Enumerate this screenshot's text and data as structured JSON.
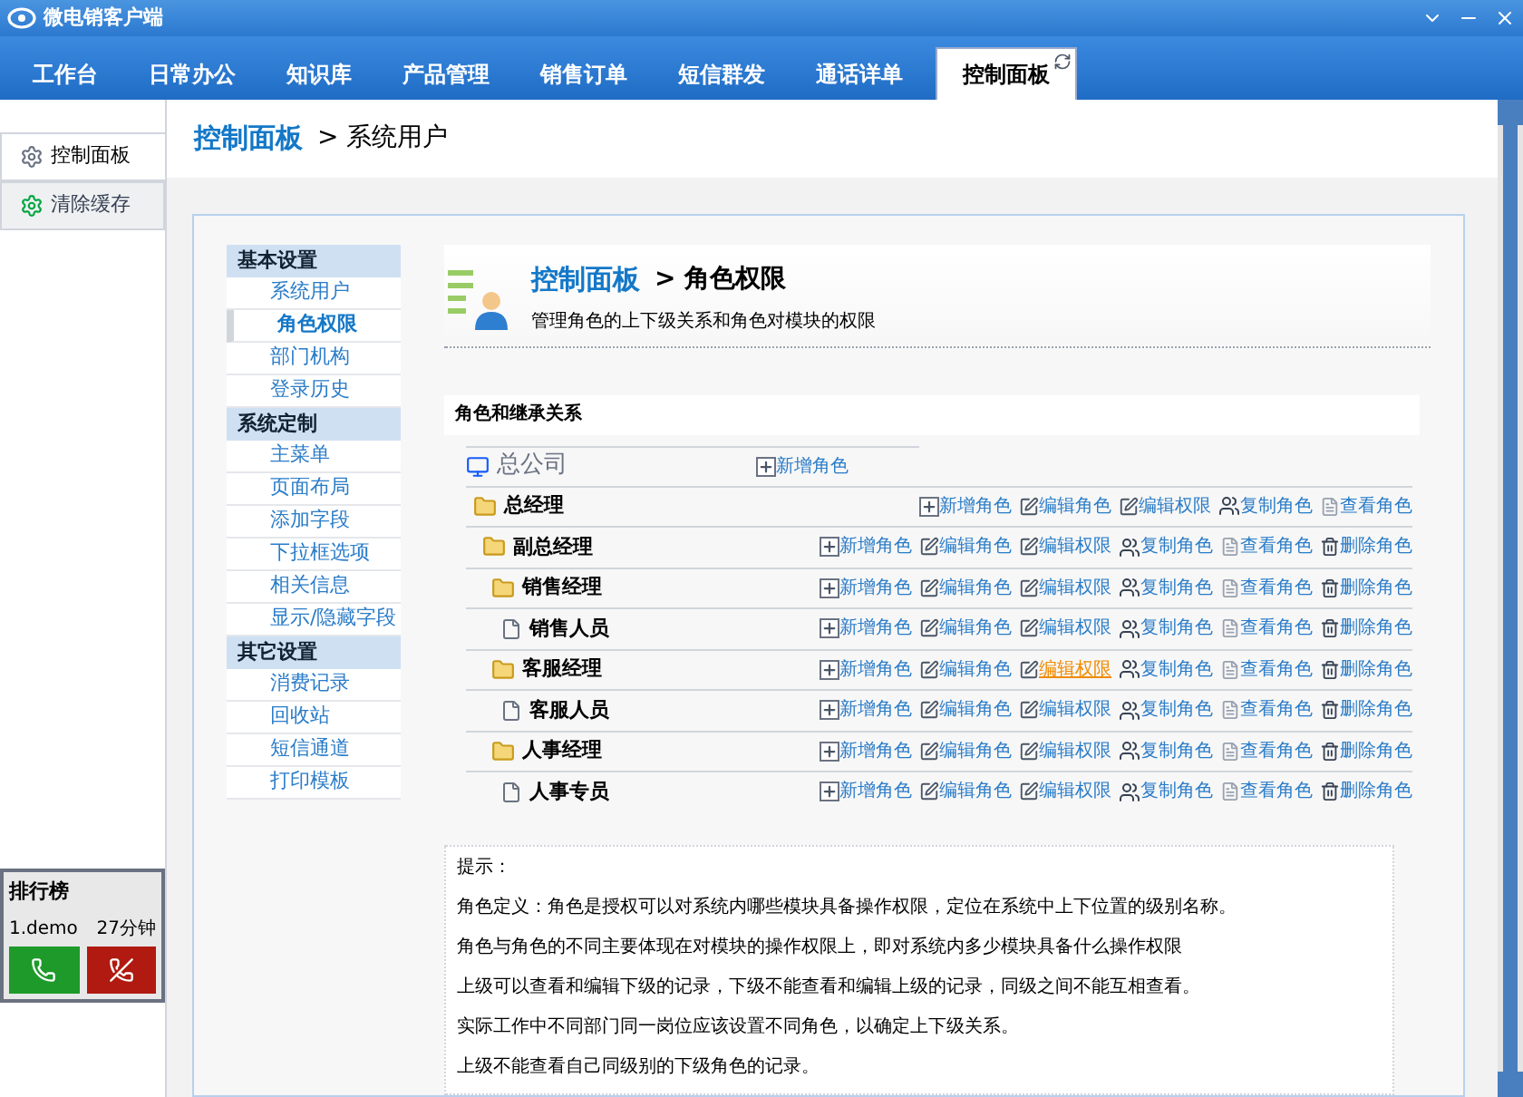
{
  "window": {
    "title": "微电销客户端"
  },
  "tabs": [
    {
      "label": "工作台",
      "selected": false
    },
    {
      "label": "日常办公",
      "selected": false
    },
    {
      "label": "知识库",
      "selected": false
    },
    {
      "label": "产品管理",
      "selected": false
    },
    {
      "label": "销售订单",
      "selected": false
    },
    {
      "label": "短信群发",
      "selected": false
    },
    {
      "label": "通话详单",
      "selected": false
    },
    {
      "label": "控制面板",
      "selected": true
    }
  ],
  "sidebar": {
    "items": [
      {
        "label": "控制面板",
        "selected": true
      },
      {
        "label": "清除缓存",
        "selected": false
      }
    ],
    "ranking": {
      "title": "排行榜",
      "rows": [
        {
          "name": "1.demo",
          "time": "27分钟"
        }
      ]
    }
  },
  "breadcrumb": {
    "root": "控制面板",
    "current": "> 系统用户"
  },
  "nav": [
    {
      "title": "基本设置",
      "items": [
        {
          "label": "系统用户",
          "selected": false
        },
        {
          "label": "角色权限",
          "selected": true
        },
        {
          "label": "部门机构",
          "selected": false
        },
        {
          "label": "登录历史",
          "selected": false
        }
      ]
    },
    {
      "title": "系统定制",
      "items": [
        {
          "label": "主菜单",
          "selected": false
        },
        {
          "label": "页面布局",
          "selected": false
        },
        {
          "label": "添加字段",
          "selected": false
        },
        {
          "label": "下拉框选项",
          "selected": false
        },
        {
          "label": "相关信息",
          "selected": false
        },
        {
          "label": "显示/隐藏字段",
          "selected": false
        }
      ]
    },
    {
      "title": "其它设置",
      "items": [
        {
          "label": "消费记录",
          "selected": false
        },
        {
          "label": "回收站",
          "selected": false
        },
        {
          "label": "短信通道",
          "selected": false
        },
        {
          "label": "打印模板",
          "selected": false
        }
      ]
    }
  ],
  "header": {
    "root": "控制面板",
    "current": "> 角色权限",
    "subtitle": "管理角色的上下级关系和角色对模块的权限"
  },
  "tree": {
    "title": "角色和继承关系",
    "root": {
      "name": "总公司",
      "kind": "company",
      "actions": [
        {
          "kind": "add",
          "label": "新增角色",
          "highlighted": false
        }
      ],
      "children": [
        {
          "name": "总经理",
          "kind": "folder",
          "actions": [
            {
              "kind": "add",
              "label": "新增角色",
              "highlighted": false
            },
            {
              "kind": "edit",
              "label": "编辑角色",
              "highlighted": false
            },
            {
              "kind": "edit",
              "label": "编辑权限",
              "highlighted": false
            },
            {
              "kind": "copy",
              "label": "复制角色",
              "highlighted": false
            },
            {
              "kind": "view",
              "label": "查看角色",
              "highlighted": false
            }
          ],
          "children": [
            {
              "name": "副总经理",
              "kind": "folder",
              "actions": [
                {
                  "kind": "add",
                  "label": "新增角色",
                  "highlighted": false
                },
                {
                  "kind": "edit",
                  "label": "编辑角色",
                  "highlighted": false
                },
                {
                  "kind": "edit",
                  "label": "编辑权限",
                  "highlighted": false
                },
                {
                  "kind": "copy",
                  "label": "复制角色",
                  "highlighted": false
                },
                {
                  "kind": "view",
                  "label": "查看角色",
                  "highlighted": false
                },
                {
                  "kind": "delete",
                  "label": "删除角色",
                  "highlighted": false
                }
              ],
              "children": [
                {
                  "name": "销售经理",
                  "kind": "folder",
                  "actions": [
                    {
                      "kind": "add",
                      "label": "新增角色",
                      "highlighted": false
                    },
                    {
                      "kind": "edit",
                      "label": "编辑角色",
                      "highlighted": false
                    },
                    {
                      "kind": "edit",
                      "label": "编辑权限",
                      "highlighted": false
                    },
                    {
                      "kind": "copy",
                      "label": "复制角色",
                      "highlighted": false
                    },
                    {
                      "kind": "view",
                      "label": "查看角色",
                      "highlighted": false
                    },
                    {
                      "kind": "delete",
                      "label": "删除角色",
                      "highlighted": false
                    }
                  ],
                  "children": [
                    {
                      "name": "销售人员",
                      "kind": "doc",
                      "actions": [
                        {
                          "kind": "add",
                          "label": "新增角色",
                          "highlighted": false
                        },
                        {
                          "kind": "edit",
                          "label": "编辑角色",
                          "highlighted": false
                        },
                        {
                          "kind": "edit",
                          "label": "编辑权限",
                          "highlighted": false
                        },
                        {
                          "kind": "copy",
                          "label": "复制角色",
                          "highlighted": false
                        },
                        {
                          "kind": "view",
                          "label": "查看角色",
                          "highlighted": false
                        },
                        {
                          "kind": "delete",
                          "label": "删除角色",
                          "highlighted": false
                        }
                      ]
                    }
                  ]
                },
                {
                  "name": "客服经理",
                  "kind": "folder",
                  "actions": [
                    {
                      "kind": "add",
                      "label": "新增角色",
                      "highlighted": false
                    },
                    {
                      "kind": "edit",
                      "label": "编辑角色",
                      "highlighted": false
                    },
                    {
                      "kind": "edit",
                      "label": "编辑权限",
                      "highlighted": true
                    },
                    {
                      "kind": "copy",
                      "label": "复制角色",
                      "highlighted": false
                    },
                    {
                      "kind": "view",
                      "label": "查看角色",
                      "highlighted": false
                    },
                    {
                      "kind": "delete",
                      "label": "删除角色",
                      "highlighted": false
                    }
                  ],
                  "children": [
                    {
                      "name": "客服人员",
                      "kind": "doc",
                      "actions": [
                        {
                          "kind": "add",
                          "label": "新增角色",
                          "highlighted": false
                        },
                        {
                          "kind": "edit",
                          "label": "编辑角色",
                          "highlighted": false
                        },
                        {
                          "kind": "edit",
                          "label": "编辑权限",
                          "highlighted": false
                        },
                        {
                          "kind": "copy",
                          "label": "复制角色",
                          "highlighted": false
                        },
                        {
                          "kind": "view",
                          "label": "查看角色",
                          "highlighted": false
                        },
                        {
                          "kind": "delete",
                          "label": "删除角色",
                          "highlighted": false
                        }
                      ]
                    }
                  ]
                },
                {
                  "name": "人事经理",
                  "kind": "folder",
                  "actions": [
                    {
                      "kind": "add",
                      "label": "新增角色",
                      "highlighted": false
                    },
                    {
                      "kind": "edit",
                      "label": "编辑角色",
                      "highlighted": false
                    },
                    {
                      "kind": "edit",
                      "label": "编辑权限",
                      "highlighted": false
                    },
                    {
                      "kind": "copy",
                      "label": "复制角色",
                      "highlighted": false
                    },
                    {
                      "kind": "view",
                      "label": "查看角色",
                      "highlighted": false
                    },
                    {
                      "kind": "delete",
                      "label": "删除角色",
                      "highlighted": false
                    }
                  ],
                  "children": [
                    {
                      "name": "人事专员",
                      "kind": "doc",
                      "actions": [
                        {
                          "kind": "add",
                          "label": "新增角色",
                          "highlighted": false
                        },
                        {
                          "kind": "edit",
                          "label": "编辑角色",
                          "highlighted": false
                        },
                        {
                          "kind": "edit",
                          "label": "编辑权限",
                          "highlighted": false
                        },
                        {
                          "kind": "copy",
                          "label": "复制角色",
                          "highlighted": false
                        },
                        {
                          "kind": "view",
                          "label": "查看角色",
                          "highlighted": false
                        },
                        {
                          "kind": "delete",
                          "label": "删除角色",
                          "highlighted": false
                        }
                      ]
                    }
                  ]
                }
              ]
            }
          ]
        }
      ]
    }
  },
  "tips": {
    "title": "提示：",
    "lines": [
      "角色定义：角色是授权可以对系统内哪些模块具备操作权限，定位在系统中上下位置的级别名称。",
      "角色与角色的不同主要体现在对模块的操作权限上，即对系统内多少模块具备什么操作权限",
      "上级可以查看和编辑下级的记录，下级不能查看和编辑上级的记录，同级之间不能互相查看。",
      "实际工作中不同部门同一岗位应该设置不同角色，以确定上下级关系。",
      "上级不能查看自己同级别的下级角色的记录。"
    ]
  }
}
